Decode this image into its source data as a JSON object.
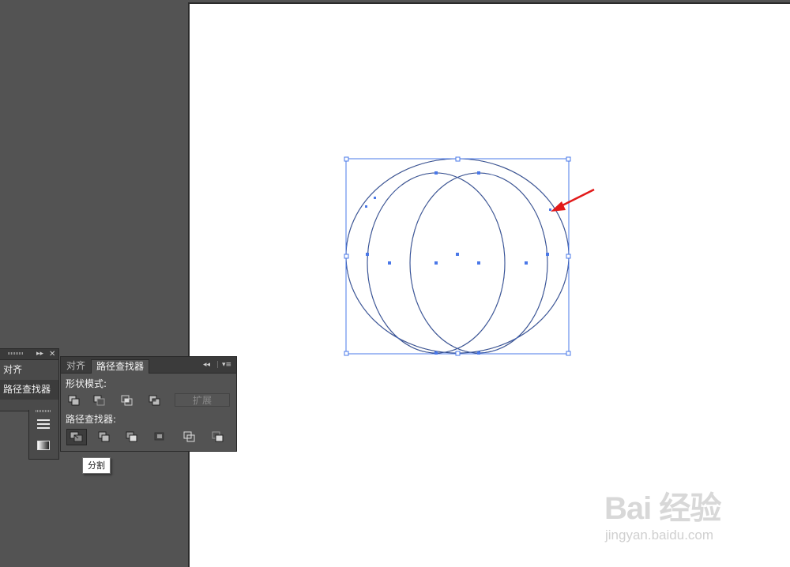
{
  "panel_group": {
    "tabs": [
      "对齐",
      "路径查找器"
    ]
  },
  "pathfinder": {
    "tabs": [
      {
        "label": "对齐",
        "active": false
      },
      {
        "label": "路径查找器",
        "active": true
      }
    ],
    "shape_modes_label": "形状模式:",
    "expand_label": "扩展",
    "pathfinders_label": "路径查找器:",
    "shape_mode_buttons": [
      "unite-icon",
      "minus-front-icon",
      "intersect-icon",
      "exclude-icon"
    ],
    "pathfinder_buttons": [
      "divide-icon",
      "trim-icon",
      "merge-icon",
      "crop-icon",
      "outline-icon",
      "minus-back-icon"
    ],
    "tooltip": "分割"
  },
  "watermark": {
    "logo": "Bai 经验",
    "url": "jingyan.baidu.com"
  },
  "colors": {
    "selection": "#4a78e8",
    "path": "#1f2a4a",
    "annotation_arrow": "#e21a1a"
  }
}
